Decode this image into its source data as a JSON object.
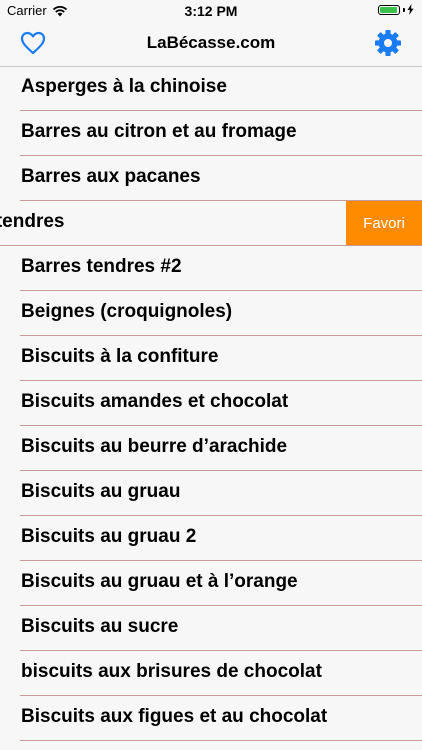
{
  "status": {
    "carrier": "Carrier",
    "time": "3:12 PM",
    "battery_level": 0.95
  },
  "nav": {
    "title": "LaBécasse.com",
    "left_icon": "heart-outline-icon",
    "right_icon": "gear-icon",
    "accent": "#1a7cf0"
  },
  "recipes": [
    "Asperges à la chinoise",
    "Barres au citron et au fromage",
    "Barres aux pacanes",
    "s tendres",
    "Barres tendres #2",
    "Beignes (croquignoles)",
    "Biscuits à la confiture",
    "Biscuits amandes et chocolat",
    "Biscuits au beurre d’arachide",
    "Biscuits au gruau",
    "Biscuits au gruau 2",
    "Biscuits au gruau et à l’orange",
    "Biscuits au sucre",
    "biscuits aux brisures de chocolat",
    "Biscuits aux figues et au chocolat"
  ],
  "swipe_action": {
    "label": "Favori",
    "color": "#ff8c00"
  }
}
